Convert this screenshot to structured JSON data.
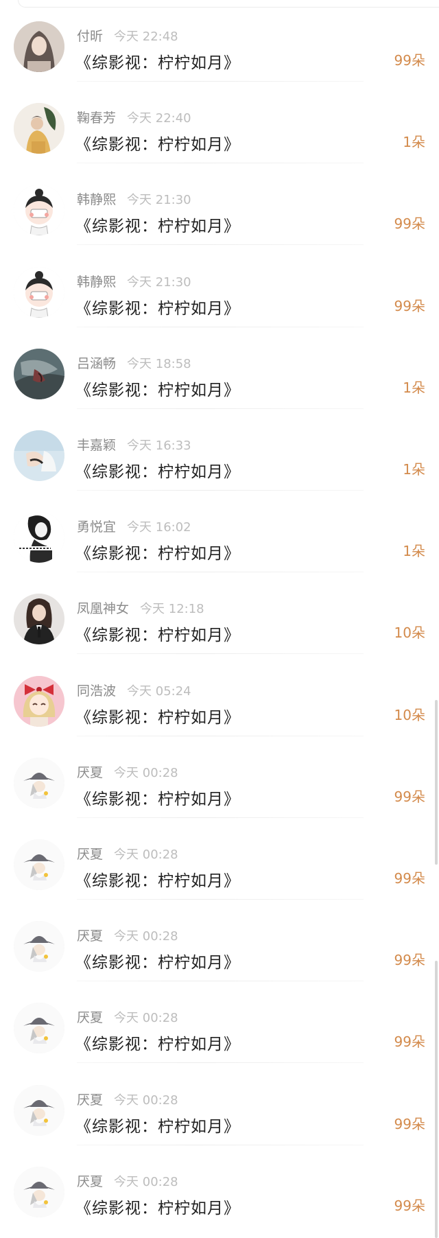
{
  "records": [
    {
      "name": "付昕",
      "time": "今天 22:48",
      "title": "《综影视：柠柠如月》",
      "amount": "99朵",
      "avatar": "avatar-girl-blur"
    },
    {
      "name": "鞠春芳",
      "time": "今天 22:40",
      "title": "《综影视：柠柠如月》",
      "amount": "1朵",
      "avatar": "avatar-girl-yellow"
    },
    {
      "name": "韩静熙",
      "time": "今天 21:30",
      "title": "《综影视：柠柠如月》",
      "amount": "99朵",
      "avatar": "avatar-cartoon-bun"
    },
    {
      "name": "韩静熙",
      "time": "今天 21:30",
      "title": "《综影视：柠柠如月》",
      "amount": "99朵",
      "avatar": "avatar-cartoon-bun"
    },
    {
      "name": "吕涵畅",
      "time": "今天 18:58",
      "title": "《综影视：柠柠如月》",
      "amount": "1朵",
      "avatar": "avatar-tattoo-dark"
    },
    {
      "name": "丰嘉颖",
      "time": "今天 16:33",
      "title": "《综影视：柠柠如月》",
      "amount": "1朵",
      "avatar": "avatar-hand-blue"
    },
    {
      "name": "勇悦宜",
      "time": "今天 16:02",
      "title": "《综影视：柠柠如月》",
      "amount": "1朵",
      "avatar": "avatar-bw-sketch"
    },
    {
      "name": "凤凰神女",
      "time": "今天 12:18",
      "title": "《综影视：柠柠如月》",
      "amount": "10朵",
      "avatar": "avatar-suit-girl"
    },
    {
      "name": "同浩波",
      "time": "今天 05:24",
      "title": "《综影视：柠柠如月》",
      "amount": "10朵",
      "avatar": "avatar-anime-bow"
    },
    {
      "name": "厌夏",
      "time": "今天 00:28",
      "title": "《综影视：柠柠如月》",
      "amount": "99朵",
      "avatar": "avatar-cartoon-hat"
    },
    {
      "name": "厌夏",
      "time": "今天 00:28",
      "title": "《综影视：柠柠如月》",
      "amount": "99朵",
      "avatar": "avatar-cartoon-hat"
    },
    {
      "name": "厌夏",
      "time": "今天 00:28",
      "title": "《综影视：柠柠如月》",
      "amount": "99朵",
      "avatar": "avatar-cartoon-hat"
    },
    {
      "name": "厌夏",
      "time": "今天 00:28",
      "title": "《综影视：柠柠如月》",
      "amount": "99朵",
      "avatar": "avatar-cartoon-hat"
    },
    {
      "name": "厌夏",
      "time": "今天 00:28",
      "title": "《综影视：柠柠如月》",
      "amount": "99朵",
      "avatar": "avatar-cartoon-hat"
    },
    {
      "name": "厌夏",
      "time": "今天 00:28",
      "title": "《综影视：柠柠如月》",
      "amount": "99朵",
      "avatar": "avatar-cartoon-hat"
    }
  ],
  "colors": {
    "amount": "#d38a4b",
    "name": "#8b8b8b",
    "time": "#bdbdbd",
    "title": "#222222"
  }
}
